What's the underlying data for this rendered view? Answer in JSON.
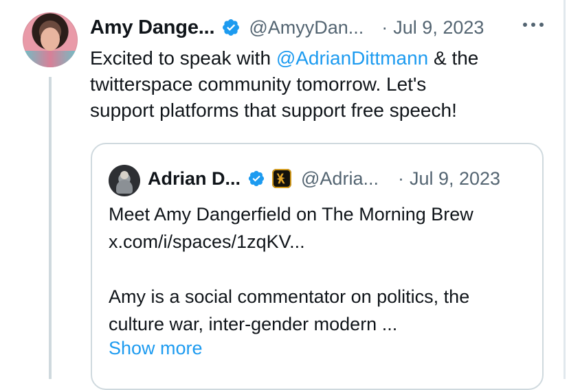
{
  "tweet": {
    "author_name": "Amy Dange...",
    "author_handle": "@AmyyDan...",
    "separator": "·",
    "date": "Jul 9, 2023",
    "text_before": "Excited to speak with ",
    "mention": "@AdrianDittmann",
    "text_after": " & the\ntwitterspace community tomorrow. Let's\nsupport platforms that support free speech!",
    "icons": {
      "verified": "verified-badge-icon",
      "more": "more-options-icon"
    }
  },
  "quote": {
    "author_name": "Adrian D...",
    "author_handle": "@Adria...",
    "separator": "·",
    "date": "Jul 9, 2023",
    "text": "Meet Amy Dangerfield on The Morning Brew\nx.com/i/spaces/1zqKV...\n\nAmy is a social commentator on politics, the\nculture war, inter-gender modern ...",
    "show_more": "Show more",
    "icons": {
      "verified": "verified-badge-icon",
      "affiliate": "affiliate-badge-icon"
    }
  },
  "colors": {
    "text": "#0f1419",
    "secondary": "#536471",
    "link": "#1d9bf0",
    "border": "#cfd9de",
    "verified": "#1d9bf0"
  }
}
